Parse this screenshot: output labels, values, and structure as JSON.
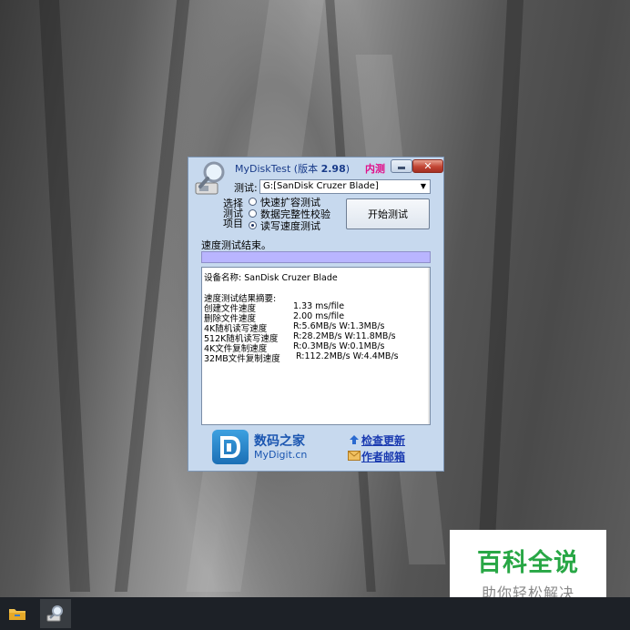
{
  "window": {
    "title_prefix": "MyDiskTest (版本 ",
    "title_version": "2.98",
    "title_suffix": ")",
    "beta_tag": "内测",
    "minimize_icon": "minimize-icon",
    "close_label": "✕"
  },
  "test": {
    "label": "测试:",
    "drive_value": "G:[SanDisk Cruzer Blade]"
  },
  "options": {
    "label_lines": [
      "选择",
      "测试",
      "项目"
    ],
    "items": [
      {
        "label": "快速扩容测试",
        "checked": false
      },
      {
        "label": "数据完整性校验",
        "checked": false
      },
      {
        "label": "读写速度测试",
        "checked": true
      }
    ]
  },
  "start_button": "开始测试",
  "status_text": "速度测试结束。",
  "progress_percent": 100,
  "result": {
    "device_line": "设备名称: SanDisk Cruzer Blade",
    "summary_title": "速度测试结果摘要:",
    "rows": [
      {
        "name": "创建文件速度",
        "value": "1.33 ms/file"
      },
      {
        "name": "删除文件速度",
        "value": "2.00 ms/file"
      },
      {
        "name": "4K随机读写速度",
        "value": "R:5.6MB/s W:1.3MB/s"
      },
      {
        "name": "512K随机读写速度",
        "value": "R:28.2MB/s W:11.8MB/s"
      },
      {
        "name": "4K文件复制速度",
        "value": "R:0.3MB/s W:0.1MB/s"
      },
      {
        "name": "32MB文件复制速度",
        "value": "R:112.2MB/s W:4.4MB/s"
      }
    ]
  },
  "footer": {
    "brand_cn": "数码之家",
    "brand_en": "MyDigit.cn",
    "link_update": "检查更新",
    "link_mail": "作者邮箱"
  },
  "watermark": {
    "title": "百科全说",
    "subtitle": "助你轻松解决"
  },
  "colors": {
    "window_bg": "#c7d9ee",
    "progress": "#b9b5ff",
    "accent_blue": "#1a55b0",
    "beta_pink": "#e0108a",
    "watermark_green": "#28a745"
  }
}
